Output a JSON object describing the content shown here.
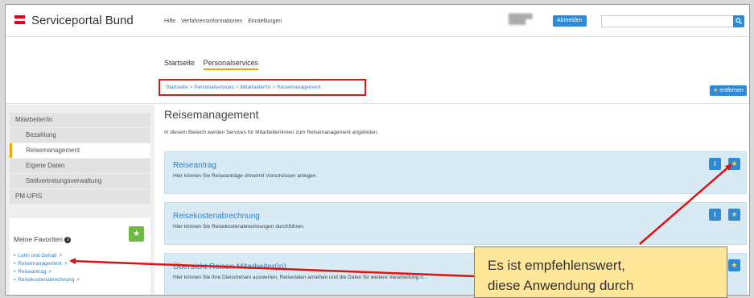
{
  "header": {
    "brand": "Serviceportal Bund",
    "nav": [
      "Hilfe",
      "Verfahrensinformationen",
      "Einstellungen"
    ],
    "logout_label": "Abmelden",
    "search_placeholder": ""
  },
  "subheader": {
    "tabs": [
      "Startseite",
      "Personalservices"
    ],
    "breadcrumb": [
      "Startseite",
      "Personalservices",
      "Mitarbeiter/in",
      "Reisemanagement"
    ],
    "breadcrumb_sep": ">",
    "remove_label": "entfernen"
  },
  "sidebar": {
    "items": [
      "Mitarbeiter/in",
      "Bezahlung",
      "Reisemanagement",
      "Eigene Daten",
      "Stellvertretungsverwaltung",
      "PM-UPIS"
    ],
    "favorites_title": "Meine Favoriten",
    "favorites": [
      "Lohn und Gehalt",
      "Reisemanagement",
      "Reiseantrag",
      "Reisekostenabrechnung"
    ]
  },
  "main": {
    "title": "Reisemanagement",
    "description": "In diesem Bereich werden Services für Mitarbeiter/innen zum Reisemanagement angeboten.",
    "cards": [
      {
        "title": "Reiseantrag",
        "desc": "Hier können Sie Reiseanträge ohne/mit Vorschüssen anlegen."
      },
      {
        "title": "Reisekostenabrechnung",
        "desc": "Hier können Sie Reisekostenabrechnungen durchführen."
      },
      {
        "title": "Übersicht Reisen Mitarbeiter(in)",
        "desc": "Hier können Sie Ihre Dienstreisen auswerten, Reisedaten ansehen und die Daten für weitere Verarbeitung n..."
      }
    ]
  },
  "callout": {
    "line1": "Es ist empfehlenswert,",
    "line2": "diese Anwendung durch"
  },
  "colors": {
    "accent": "#2d8ad9",
    "brand_red": "#e2001a",
    "active_marker": "#f0a500",
    "card_bg": "#d8eaf4",
    "annotation_red": "#e11111",
    "callout_bg": "#ffe699"
  }
}
